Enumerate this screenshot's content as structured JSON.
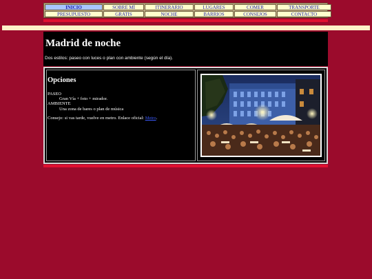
{
  "nav": {
    "items": [
      {
        "label": "INICIO",
        "active": true
      },
      {
        "label": "SOBRE MÍ"
      },
      {
        "label": "ITINERARIO"
      },
      {
        "label": "LUGARES"
      },
      {
        "label": "COMER"
      },
      {
        "label": "TRANSPORTE"
      },
      {
        "label": "PRESUPUESTO"
      },
      {
        "label": "GRATIS"
      },
      {
        "label": "NOCHE"
      },
      {
        "label": "BARRIOS"
      },
      {
        "label": "CONSEJOS"
      },
      {
        "label": "CONTACTO"
      }
    ]
  },
  "header": {
    "title": "Madrid de noche",
    "subtitle": "Dos estilos: paseo con luces o plan con ambiente (según el día)."
  },
  "options": {
    "heading": "Opciones",
    "paseo_label": "PASEO",
    "paseo_text": "Gran Vía + foto + mirador.",
    "ambiente_label": "AMBIENTE",
    "ambiente_text": "Una zona de bares o plan de música",
    "tip_text": "Consejo: si vas tarde, vuelve en metro. Enlace oficial: ",
    "tip_link": "Metro",
    "tip_end": "."
  },
  "colors": {
    "background": "#9b0b2c",
    "accent_bar": "#e01030",
    "cream_bar": "#fff1c8",
    "nav_cell": "#ffffcc",
    "nav_active": "#a9c6ff"
  }
}
